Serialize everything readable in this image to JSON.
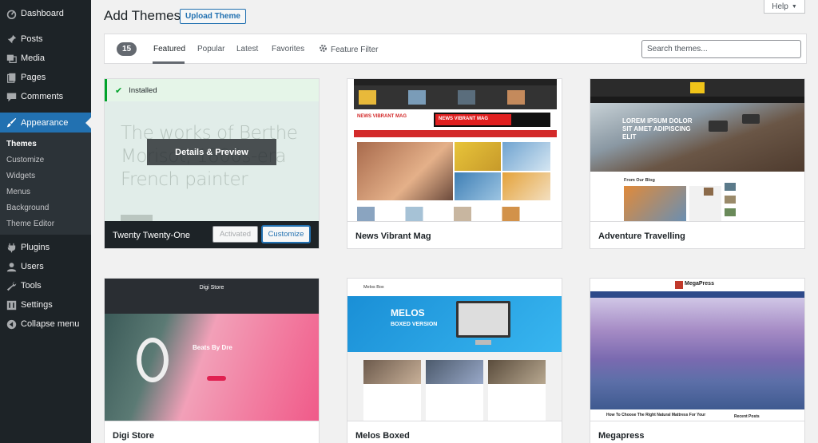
{
  "sidebar": {
    "items": [
      {
        "label": "Dashboard",
        "icon": "dashboard-icon"
      },
      {
        "label": "Posts",
        "icon": "pin-icon"
      },
      {
        "label": "Media",
        "icon": "media-icon"
      },
      {
        "label": "Pages",
        "icon": "pages-icon"
      },
      {
        "label": "Comments",
        "icon": "comment-icon"
      },
      {
        "label": "Appearance",
        "icon": "brush-icon",
        "active": true
      }
    ],
    "submenu": [
      "Themes",
      "Customize",
      "Widgets",
      "Menus",
      "Background",
      "Theme Editor"
    ],
    "items_after": [
      {
        "label": "Plugins",
        "icon": "plug-icon"
      },
      {
        "label": "Users",
        "icon": "user-icon"
      },
      {
        "label": "Tools",
        "icon": "wrench-icon"
      },
      {
        "label": "Settings",
        "icon": "settings-icon"
      },
      {
        "label": "Collapse menu",
        "icon": "collapse-icon"
      }
    ]
  },
  "header": {
    "title": "Add Themes",
    "upload_label": "Upload Theme",
    "help_label": "Help"
  },
  "filter": {
    "count": "15",
    "tabs": [
      "Featured",
      "Popular",
      "Latest",
      "Favorites"
    ],
    "feature_filter": "Feature Filter",
    "search_placeholder": "Search themes..."
  },
  "themes": [
    {
      "name": "Twenty Twenty-One",
      "installed_label": "Installed",
      "tagline": "The works of Berthe Morisot, 1800s-era French painter",
      "details_label": "Details & Preview",
      "activated_label": "Activated",
      "customize_label": "Customize"
    },
    {
      "name": "News Vibrant Mag",
      "logo": "NEWS VIBRANT MAG",
      "banner": "NEWS VIBRANT MAG"
    },
    {
      "name": "Adventure Travelling",
      "hero": "LOREM IPSUM DOLOR SIT AMET ADIPISCING ELIT",
      "section": "From Our Blog"
    },
    {
      "name": "Digi Store",
      "logo": "Digi Store",
      "hero": "Beats By Dre"
    },
    {
      "name": "Melos Boxed",
      "logo": "Melos Box",
      "hero": "MELOS",
      "hero_sub": "BOXED VERSION"
    },
    {
      "name": "Megapress",
      "logo": "MegaPress",
      "post": "How To Choose The Right Natural Mattress For Your",
      "widget": "Recent Posts"
    }
  ],
  "colors": {
    "sidebar_bg": "#1d2327",
    "accent": "#2271b1",
    "installed_green": "#00a32a"
  }
}
